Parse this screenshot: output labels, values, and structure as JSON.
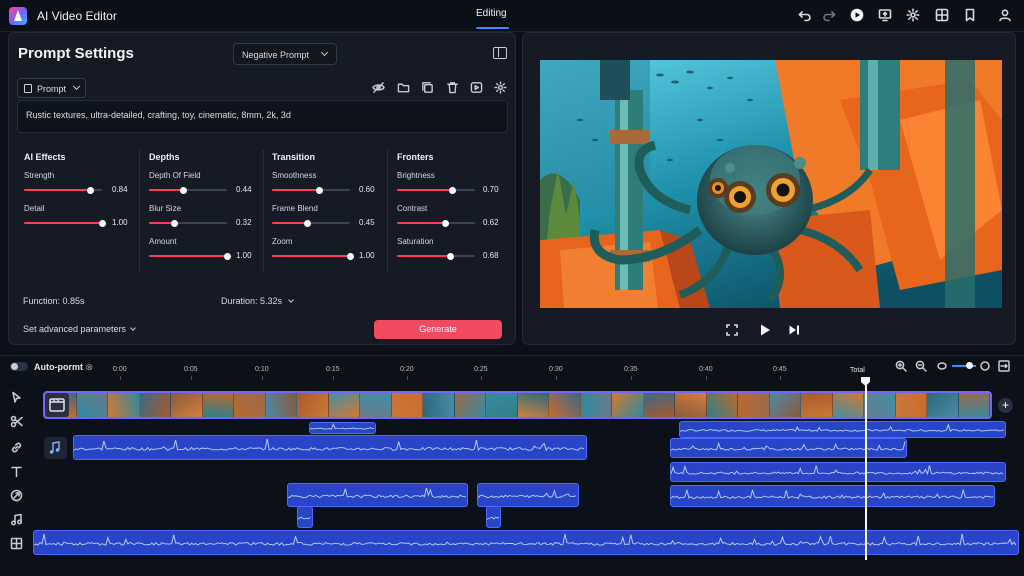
{
  "app": {
    "title": "AI Video Editor",
    "active_tab": "Editing"
  },
  "toolbar_icons": [
    "undo-icon",
    "redo-icon",
    "play-icon",
    "export-icon",
    "settings-icon",
    "grid-icon",
    "bookmark-icon",
    "user-icon"
  ],
  "settings": {
    "title": "Prompt Settings",
    "negative_prompt_label": "Negative Prompt",
    "prompt_label": "Prompt",
    "prompt_text": "Rustic textures, ultra-detailed, crafting, toy, cinematic, 8mm, 2k, 3d",
    "groups": [
      {
        "title": "AI Effects",
        "sliders": [
          {
            "label": "Strength",
            "value": "0.84",
            "level": 0.84
          },
          {
            "label": "Detail",
            "value": "1.00",
            "level": 1.0
          }
        ]
      },
      {
        "title": "Depths",
        "sliders": [
          {
            "label": "Depth Of Field",
            "value": "0.44",
            "level": 0.44
          },
          {
            "label": "Blur Size",
            "value": "0.32",
            "level": 0.32
          },
          {
            "label": "Amount",
            "value": "1.00",
            "level": 1.0
          }
        ]
      },
      {
        "title": "Transition",
        "sliders": [
          {
            "label": "Smoothness",
            "value": "0.60",
            "level": 0.6
          },
          {
            "label": "Frame Blend",
            "value": "0.45",
            "level": 0.45
          },
          {
            "label": "Zoom",
            "value": "1.00",
            "level": 1.0
          }
        ]
      },
      {
        "title": "Fronters",
        "sliders": [
          {
            "label": "Brightness",
            "value": "0.70",
            "level": 0.7
          },
          {
            "label": "Contrast",
            "value": "0.62",
            "level": 0.62
          },
          {
            "label": "Saturation",
            "value": "0.68",
            "level": 0.68
          }
        ]
      }
    ],
    "function_text": "Function: 0.85s",
    "duration_text": "Duration: 5.32s",
    "advanced_label": "Set advanced parameters",
    "generate_label": "Generate"
  },
  "timeline": {
    "auto_label": "Auto-pormt",
    "ticks": [
      "0:00",
      "0:05",
      "0:10",
      "0:15",
      "0:20",
      "0:25",
      "0:30",
      "0:35",
      "0:40",
      "0:45"
    ],
    "total_label": "Total",
    "zoom_level": 0.6
  },
  "colors": {
    "accent": "#3d8bff",
    "slider": "#ff3d5a",
    "generate": "#f24b60",
    "clip_border": "#7565ff",
    "audio": "#2845c8"
  }
}
